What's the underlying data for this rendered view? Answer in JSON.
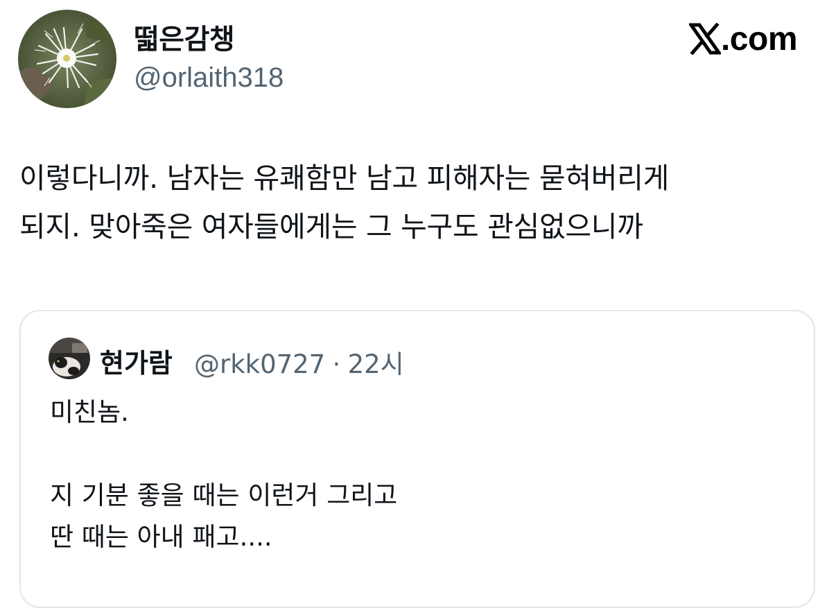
{
  "tweet": {
    "author": {
      "display_name": "떫은감챙",
      "handle": "@orlaith318",
      "avatar_icon": "flower-avatar-icon"
    },
    "site": {
      "logo_text": ".com",
      "logo_icon": "x-logo-icon"
    },
    "body_lines": [
      "이렇다니까. 남자는 유쾌함만 남고 피해자는 묻혀버리게",
      "되지. 맞아죽은 여자들에게는 그 누구도 관심없으니까"
    ],
    "quote": {
      "display_name": "현가람",
      "handle": "@rkk0727",
      "separator": "·",
      "time": "22시",
      "avatar_icon": "cat-avatar-icon",
      "lines": [
        "미친놈.",
        "",
        "지 기분 좋을 때는 이런거 그리고",
        "딴 때는 아내 패고...."
      ]
    }
  },
  "colors": {
    "text_primary": "#0f1419",
    "text_secondary": "#536471",
    "card_border": "#e1e6ea",
    "background": "#ffffff"
  }
}
